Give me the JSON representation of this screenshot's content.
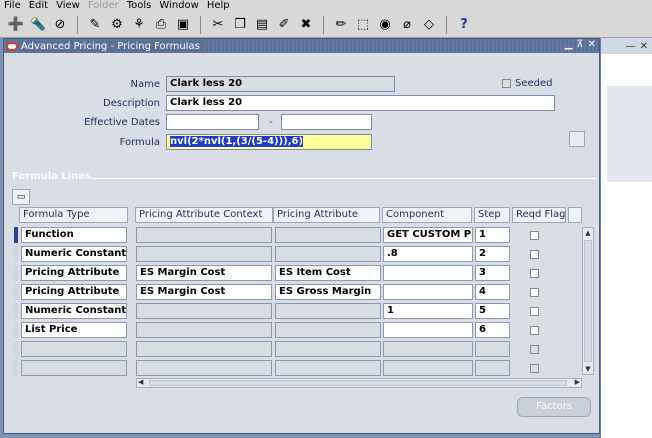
{
  "menu": [
    "File",
    "Edit",
    "View",
    "Folder",
    "Tools",
    "Window",
    "Help"
  ],
  "menu_disabled": [
    "Folder"
  ],
  "toolbar_icons": [
    "new-icon",
    "find-icon",
    "navigator-icon",
    "save-icon",
    "next-step-icon",
    "switch-responsibility-icon",
    "print-icon",
    "close-form-icon",
    "cut-icon",
    "copy-icon",
    "paste-icon",
    "clear-record-icon",
    "delete-record-icon",
    "edit-field-icon",
    "zoom-icon",
    "translations-icon",
    "attachments-icon",
    "folder-tools-icon",
    "help-icon"
  ],
  "window": {
    "title": "Advanced Pricing - Pricing Formulas"
  },
  "form": {
    "name_label": "Name",
    "name_value": "Clark less 20",
    "seeded_label": "Seeded",
    "description_label": "Description",
    "description_value": "Clark less 20",
    "effective_dates_label": "Effective Dates",
    "date_separator": "-",
    "formula_label": "Formula",
    "formula_value": "nvl(2*nvl(1,(3/(5-4))),6)"
  },
  "formula_lines": {
    "section_title": "Formula Lines",
    "columns": [
      "Formula Type",
      "Pricing Attribute Context",
      "Pricing Attribute",
      "Component",
      "Step",
      "Reqd Flag"
    ],
    "rows": [
      {
        "type": "Function",
        "context": "",
        "attribute": "",
        "component": "GET CUSTOM PRI",
        "step": "1",
        "reqd": false
      },
      {
        "type": "Numeric Constant",
        "context": "",
        "attribute": "",
        "component": ".8",
        "step": "2",
        "reqd": false
      },
      {
        "type": "Pricing Attribute",
        "context": "ES Margin Cost",
        "attribute": "ES Item Cost",
        "component": "",
        "step": "3",
        "reqd": false
      },
      {
        "type": "Pricing Attribute",
        "context": "ES Margin Cost",
        "attribute": "ES Gross Margin",
        "component": "",
        "step": "4",
        "reqd": false
      },
      {
        "type": "Numeric Constant",
        "context": "",
        "attribute": "",
        "component": "1",
        "step": "5",
        "reqd": false
      },
      {
        "type": "List Price",
        "context": "",
        "attribute": "",
        "component": "",
        "step": "6",
        "reqd": false
      }
    ],
    "empty_rows": 2
  },
  "buttons": {
    "factors": "Factors"
  }
}
